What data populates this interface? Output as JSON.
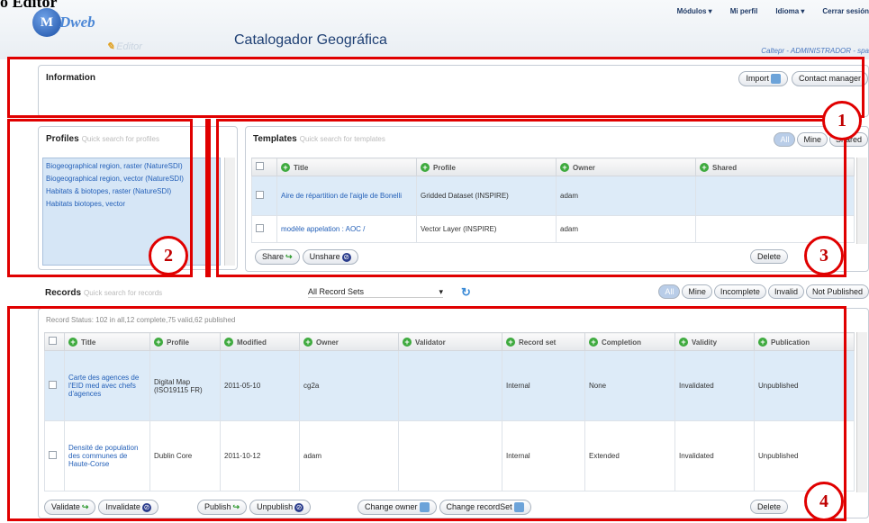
{
  "doc_title": "o Editor",
  "header": {
    "logo_text": "Dweb",
    "logo_letter": "M",
    "editor_tag": "Editor",
    "app_title": "Catalogador Geográfica",
    "nav": [
      "Módulos ▾",
      "Mi perfil",
      "Idioma ▾",
      "Cerrar sesión"
    ],
    "user": "Caltepr - ADMINISTRADOR - spa"
  },
  "information": {
    "title": "Information",
    "import_label": "Import",
    "contact_label": "Contact manager"
  },
  "profiles": {
    "title": "Profiles",
    "placeholder": "Quick search for profiles",
    "items": [
      "Biogeographical region, raster (NatureSDI)",
      "Biogeographical region, vector (NatureSDI)",
      "Habitats & biotopes, raster (NatureSDI)",
      "Habitats biotopes, vector"
    ]
  },
  "templates": {
    "title": "Templates",
    "placeholder": "Quick search for templates",
    "filters": [
      "All",
      "Mine",
      "Shared"
    ],
    "columns": [
      "Title",
      "Profile",
      "Owner",
      "Shared"
    ],
    "rows": [
      {
        "title": "Aire de répartition de l'aigle de Bonelli",
        "profile": "Gridded Dataset (INSPIRE)",
        "owner": "adam",
        "shared": ""
      },
      {
        "title": "modèle appelation : AOC /",
        "profile": "Vector Layer (INSPIRE)",
        "owner": "adam",
        "shared": ""
      }
    ],
    "share_label": "Share",
    "unshare_label": "Unshare",
    "delete_label": "Delete"
  },
  "records": {
    "title": "Records",
    "placeholder": "Quick search for records",
    "recordset_select": "All Record Sets",
    "filters": [
      "All",
      "Mine",
      "Incomplete",
      "Invalid",
      "Not Published"
    ],
    "status": "Record Status: 102 in all,12 complete,75 valid,62 published",
    "columns": [
      "Title",
      "Profile",
      "Modified",
      "Owner",
      "Validator",
      "Record set",
      "Completion",
      "Validity",
      "Publication"
    ],
    "rows": [
      {
        "title": "Carte des agences de l'EID med avec chefs d'agences",
        "profile": "Digital Map (ISO19115 FR)",
        "modified": "2011-05-10",
        "owner": "cg2a",
        "validator": "",
        "recordset": "Internal",
        "completion": "None",
        "validity": "Invalidated",
        "publication": "Unpublished"
      },
      {
        "title": "Densité de population des communes de Haute-Corse",
        "profile": "Dublin Core",
        "modified": "2011-10-12",
        "owner": "adam",
        "validator": "",
        "recordset": "Internal",
        "completion": "Extended",
        "validity": "Invalidated",
        "publication": "Unpublished"
      }
    ],
    "validate_label": "Validate",
    "invalidate_label": "Invalidate",
    "publish_label": "Publish",
    "unpublish_label": "Unpublish",
    "change_owner_label": "Change owner",
    "change_recordset_label": "Change recordSet",
    "delete_label": "Delete"
  },
  "badges": [
    "1",
    "2",
    "3",
    "4"
  ],
  "colors": {
    "annotation": "#e00000",
    "accent": "#2460b8",
    "header_text": "#1e3f73"
  }
}
